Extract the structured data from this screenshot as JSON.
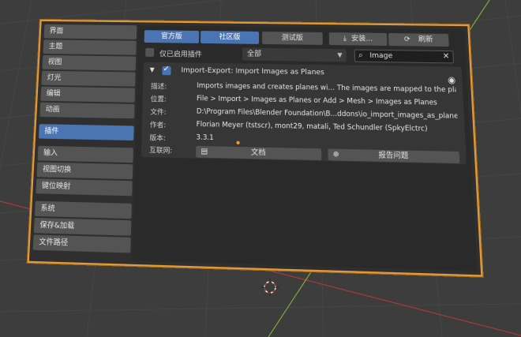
{
  "sidebar": {
    "group1": [
      "界面",
      "主题",
      "视图",
      "灯光",
      "编辑",
      "动画"
    ],
    "active": "插件",
    "group2": [
      "输入",
      "视图切换",
      "键位映射"
    ],
    "group3": [
      "系统",
      "保存&加载",
      "文件路径"
    ]
  },
  "tabs": {
    "official": "官方版",
    "community": "社区版",
    "testing": "测试版",
    "install": "安装...",
    "refresh": "刷新",
    "install_icon": "download-icon",
    "refresh_icon": "refresh-icon"
  },
  "filter": {
    "enabled_only_label": "仅已启用插件",
    "category_value": "全部",
    "search_value": "Image"
  },
  "addon": {
    "title": "Import-Export: Import Images as Planes",
    "enabled": true,
    "rows": [
      {
        "key": "描述:",
        "value": "Imports images and creates planes wi... The images are mapped to the planes."
      },
      {
        "key": "位置:",
        "value": "File > Import > Images as Planes or Add > Mesh > Images as Planes"
      },
      {
        "key": "文件:",
        "value": "D:\\Program Files\\Blender Foundation\\B...ddons\\io_import_images_as_planes.py"
      },
      {
        "key": "作者:",
        "value": "Florian Meyer (tstscr), mont29, matali, Ted Schundler (SpkyElctrc)"
      },
      {
        "key": "版本:",
        "value": "3.3.1"
      }
    ],
    "web_key": "互联网:",
    "docs_label": "文档",
    "report_label": "报告问题"
  },
  "colors": {
    "accent": "#4b74b3",
    "window_border": "#e59a3a",
    "grid_red": "#a83a3a",
    "grid_green": "#7ea83a"
  }
}
